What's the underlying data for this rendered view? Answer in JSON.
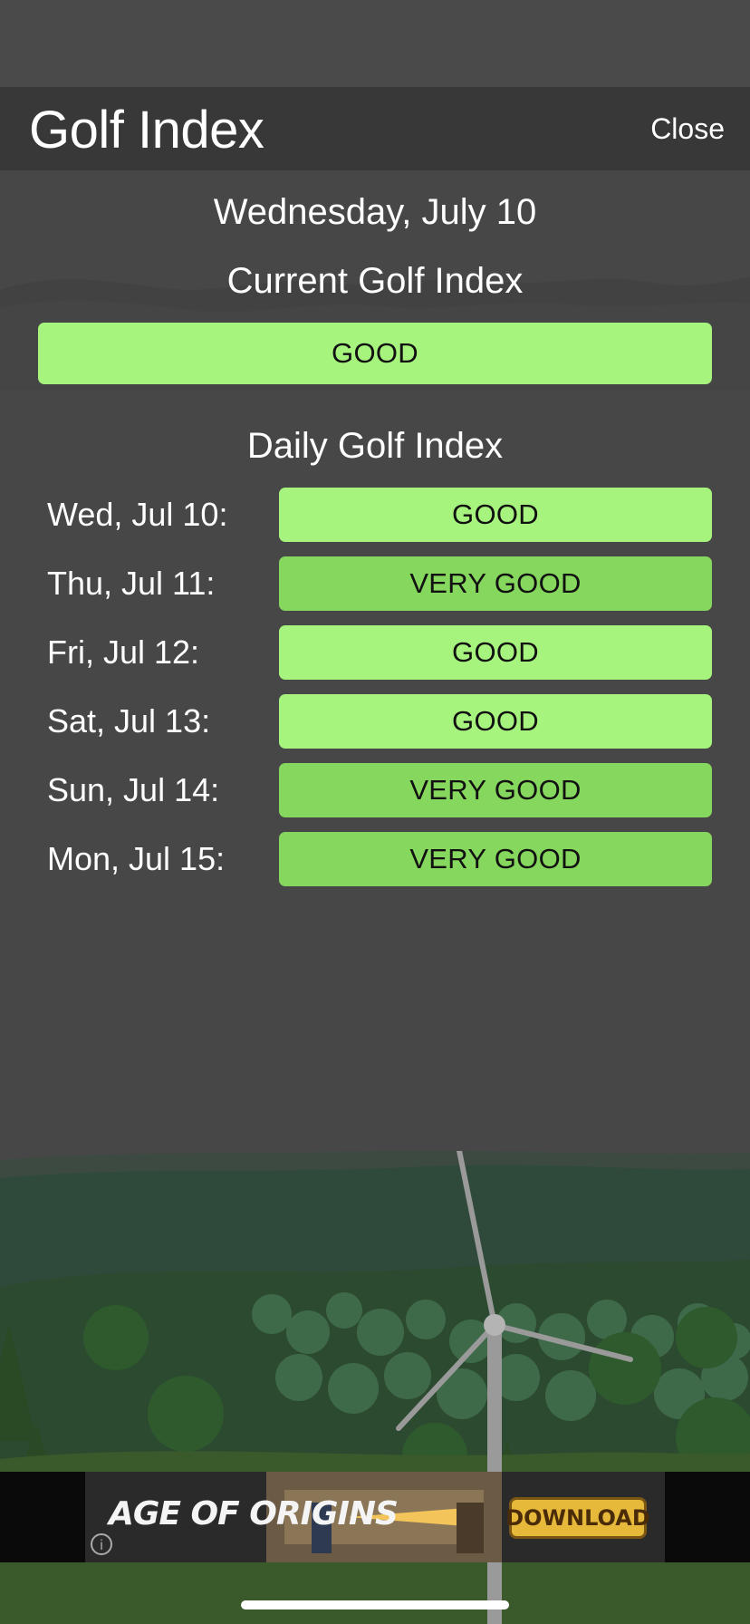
{
  "header": {
    "title": "Golf Index",
    "close_label": "Close"
  },
  "date": "Wednesday, July 10",
  "current": {
    "heading": "Current Golf Index",
    "value": "GOOD"
  },
  "daily": {
    "heading": "Daily Golf Index",
    "rows": [
      {
        "day": "Wed, Jul 10:",
        "value": "GOOD"
      },
      {
        "day": "Thu, Jul 11:",
        "value": "VERY GOOD"
      },
      {
        "day": "Fri, Jul 12:",
        "value": "GOOD"
      },
      {
        "day": "Sat, Jul 13:",
        "value": "GOOD"
      },
      {
        "day": "Sun, Jul 14:",
        "value": "VERY GOOD"
      },
      {
        "day": "Mon, Jul 15:",
        "value": "VERY GOOD"
      }
    ]
  },
  "colors": {
    "good": "#a6f37d",
    "very_good": "#86d75d",
    "header_bg": "#383838",
    "page_bg": "#474747"
  },
  "ad": {
    "title": "AGE OF ORIGINS",
    "cta": "DOWNLOAD",
    "info_icon": "info-icon"
  }
}
